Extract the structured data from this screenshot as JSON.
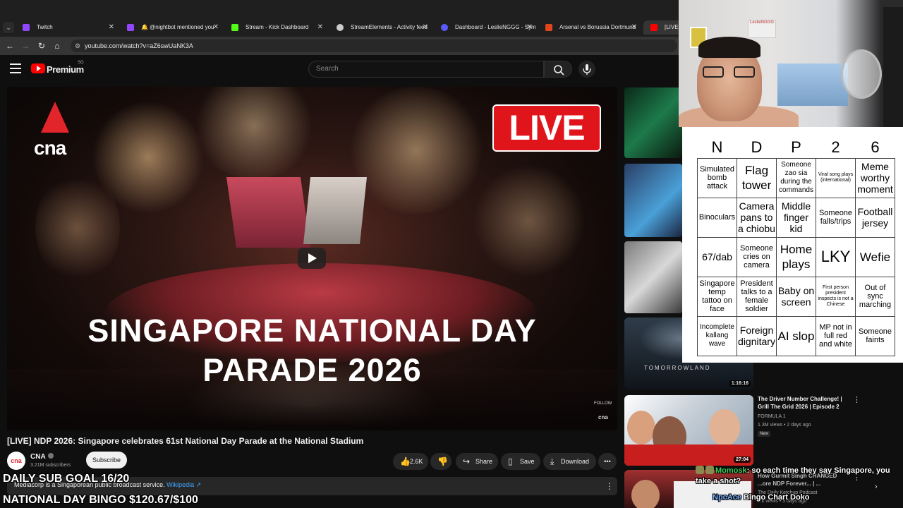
{
  "browser": {
    "tabs": [
      {
        "label": "Twitch",
        "favicon_color": "#9146ff"
      },
      {
        "label": "🔔 @nightbot mentioned you",
        "favicon_color": "#9146ff"
      },
      {
        "label": "Stream - Kick Dashboard",
        "favicon_color": "#53fc18"
      },
      {
        "label": "StreamElements - Activity feed",
        "favicon_color": "#cccccc"
      },
      {
        "label": "Dashboard - LeslieNGGG - Sym",
        "favicon_color": "#5a5aff"
      },
      {
        "label": "Arsenal vs Borussia Dortmund",
        "favicon_color": "#e0451c"
      },
      {
        "label": "[LIVE] N",
        "favicon_color": "#ff0000"
      }
    ],
    "url": "youtube.com/watch?v=aZ6swUaNK3A"
  },
  "youtube": {
    "brand": "Premium",
    "region": "SG",
    "search_placeholder": "Search"
  },
  "video": {
    "overlay_line1": "SINGAPORE NATIONAL DAY",
    "overlay_line2": "PARADE 2026",
    "live_badge": "LIVE",
    "logo": "cna",
    "follow": "FOLLOW",
    "follow_logo": "cna",
    "title": "[LIVE] NDP 2026: Singapore celebrates 61st National Day Parade at the National Stadium"
  },
  "channel": {
    "avatar": "cna",
    "name": "CNA",
    "subscribers": "3.21M subscribers",
    "subscribe_label": "Subscribe"
  },
  "actions": {
    "likes": "2.6K",
    "share": "Share",
    "save": "Save",
    "download": "Download"
  },
  "description": {
    "text": "Mediacorp is a Singaporean public broadcast service.",
    "link": "Wikipedia ↗"
  },
  "stream_overlay": {
    "sub_goal": "DAILY SUB GOAL 16/20",
    "bingo_goal": "NATIONAL DAY BINGO $120.67/$100"
  },
  "sidebar": {
    "card1": {
      "brand": "TOMORROWLAND",
      "duration": "1:16:16"
    },
    "card2": {
      "title": "The Driver Number Challenge! | Grill The Grid 2026 | Episode 2",
      "channel": "FORMULA 1",
      "meta": "1.3M views • 2 days ago",
      "badge": "New",
      "duration": "27:04"
    },
    "card3": {
      "title": "How Gurmit Singh CHANGED ...ore NDP Forever... | ...",
      "channel": "The Daily Ketchup Podcast",
      "meta": "...k views • 3 days ago"
    }
  },
  "bingo": {
    "headers": [
      "N",
      "D",
      "P",
      "2",
      "6"
    ],
    "rows": [
      [
        "Simulated bomb attack",
        "Flag tower",
        "Someone zao sia during the commands",
        "Viral song plays (international)",
        "Meme worthy moment"
      ],
      [
        "Binoculars",
        "Camera pans to a chiobu",
        "Middle finger kid",
        "Someone falls/trips",
        "Football jersey"
      ],
      [
        "67/dab",
        "Someone cries on camera",
        "Home plays",
        "LKY",
        "Wefie"
      ],
      [
        "Singapore temp tattoo on face",
        "President talks to a female soldier",
        "Baby on screen",
        "First person president inspects is not a Chinese",
        "Out of sync marching"
      ],
      [
        "Incomplete kallang wave",
        "Foreign dignitary",
        "AI slop",
        "MP not in full red and white",
        "Someone faints"
      ]
    ]
  },
  "webcam": {
    "sign_text": "LeslieNGGG"
  },
  "chat": {
    "user1": "Momosk",
    "msg1": "so each time they say Singapore, you take a shot?",
    "user2": "NpcAce",
    "msg2": "Bingo Chart Doko"
  }
}
